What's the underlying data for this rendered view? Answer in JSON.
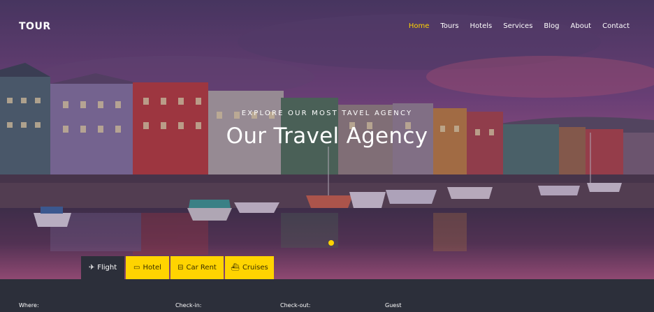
{
  "brand": {
    "name": "TOUR"
  },
  "nav": {
    "items": [
      {
        "label": "Home",
        "active": true
      },
      {
        "label": "Tours",
        "active": false
      },
      {
        "label": "Hotels",
        "active": false
      },
      {
        "label": "Services",
        "active": false
      },
      {
        "label": "Blog",
        "active": false
      },
      {
        "label": "About",
        "active": false
      },
      {
        "label": "Contact",
        "active": false
      }
    ]
  },
  "hero": {
    "eyebrow": "EXPLORE OUR MOST TAVEL AGENCY",
    "title": "Our Travel Agency",
    "slider_dots": 1
  },
  "search_tabs": {
    "items": [
      {
        "label": "Flight",
        "icon": "airplane-icon",
        "active": true
      },
      {
        "label": "Hotel",
        "icon": "bed-icon",
        "active": false
      },
      {
        "label": "Car Rent",
        "icon": "car-icon",
        "active": false
      },
      {
        "label": "Cruises",
        "icon": "ship-icon",
        "active": false
      }
    ]
  },
  "search_form": {
    "where_label": "Where:",
    "checkin_label": "Check-in:",
    "checkout_label": "Check-out:",
    "guest_label": "Guest"
  },
  "colors": {
    "accent": "#ffd400",
    "dark": "#2c2f3a",
    "text": "#ffffff"
  }
}
